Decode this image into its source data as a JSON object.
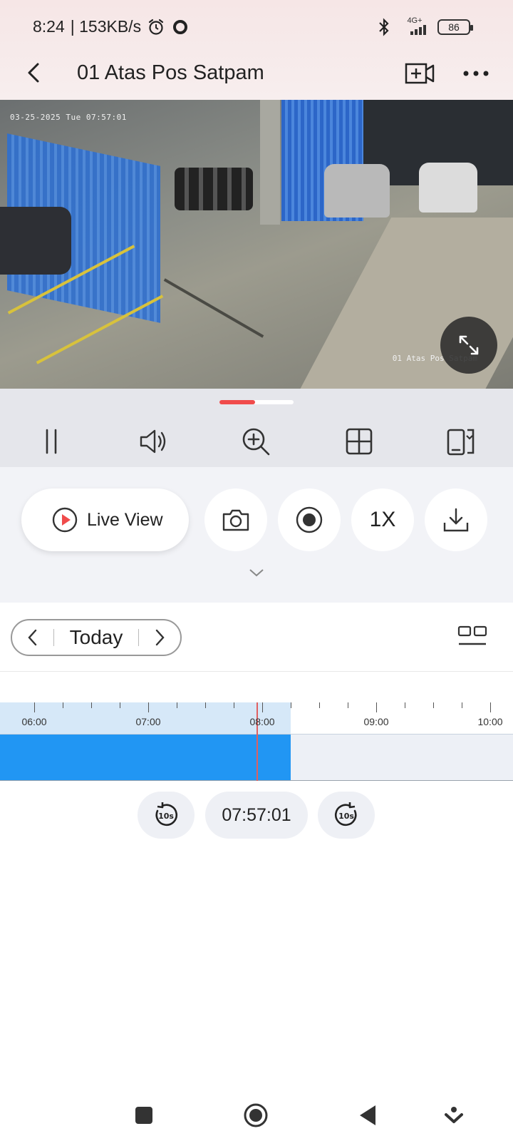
{
  "status_bar": {
    "time": "8:24",
    "speed": "| 153KB/s",
    "network": "4G+",
    "battery": "86"
  },
  "header": {
    "title": "01 Atas Pos Satpam",
    "icons": [
      "back-icon",
      "add-camera-icon",
      "more-icon"
    ]
  },
  "video": {
    "timestamp": "03-25-2025 Tue 07:57:01",
    "camera_label": "01 Atas Pos Satpam"
  },
  "controls": {
    "icons": [
      "pause-icon",
      "volume-icon",
      "zoom-icon",
      "grid-split-icon",
      "rotate-screen-icon"
    ]
  },
  "actions": {
    "live_view_label": "Live View",
    "speed_label": "1X",
    "icons": [
      "play-icon",
      "camera-snapshot-icon",
      "record-icon",
      "download-icon",
      "chevron-down-icon"
    ]
  },
  "timeline": {
    "date_label": "Today",
    "ticks": [
      "06:00",
      "07:00",
      "08:00",
      "09:00",
      "10:00"
    ],
    "current_time": "07:57:01",
    "recorded_until": "08:15"
  },
  "colors": {
    "accent": "#f04b4b",
    "recording": "#2196f3",
    "ruler_bg": "#d6e8f8"
  },
  "navbar": {
    "icons": [
      "recent-apps-icon",
      "home-icon",
      "back-nav-icon",
      "assistant-icon"
    ]
  }
}
